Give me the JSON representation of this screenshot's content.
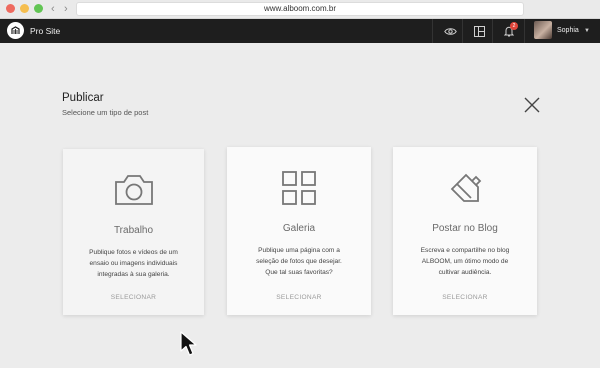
{
  "browser": {
    "url": "www.alboom.com.br"
  },
  "appbar": {
    "brand": "Pro Site",
    "notification_count": "2",
    "user_name": "Sophia"
  },
  "header": {
    "title": "Publicar",
    "subtitle": "Selecione um tipo de post"
  },
  "cards": [
    {
      "icon": "camera-icon",
      "title": "Trabalho",
      "description": "Publique fotos e vídeos de um ensaio ou imagens individuais integradas à sua galeria.",
      "action": "SELECIONAR"
    },
    {
      "icon": "grid-icon",
      "title": "Galeria",
      "description": "Publique uma página com a seleção de fotos que desejar. Que tal suas favoritas?",
      "action": "SELECIONAR"
    },
    {
      "icon": "pencil-icon",
      "title": "Postar no Blog",
      "description": "Escreva e compartilhe no blog ALBOOM, um ótimo modo de cultivar audiência.",
      "action": "SELECIONAR"
    }
  ]
}
